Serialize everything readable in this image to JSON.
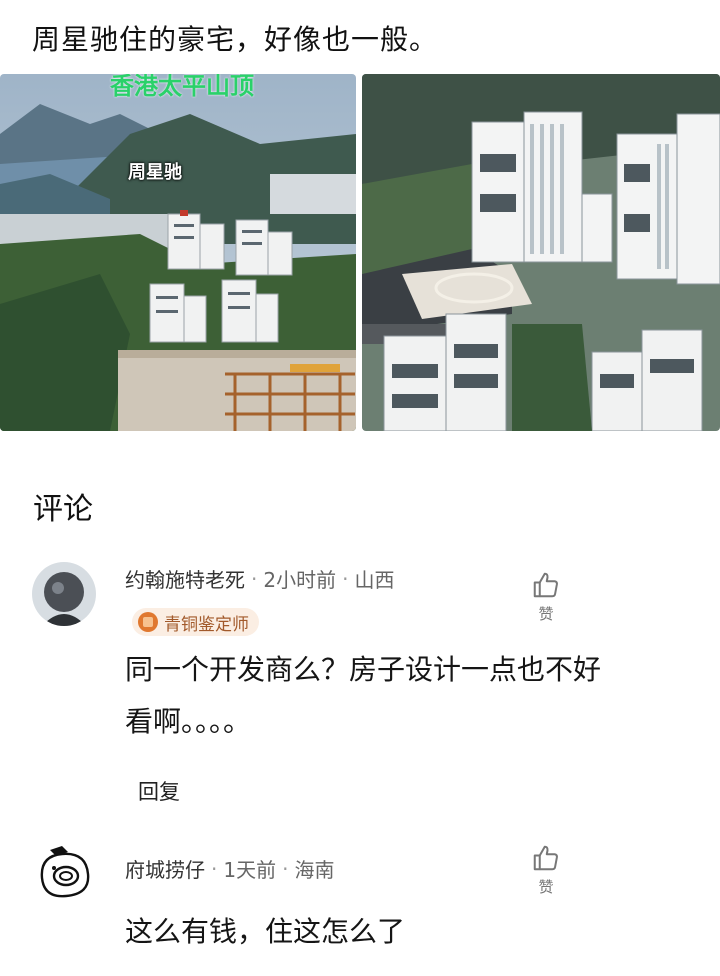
{
  "post": {
    "title": "周星驰住的豪宅，好像也一般。",
    "photos": [
      {
        "top_caption": "香港太平山顶",
        "label": "周星驰"
      },
      {}
    ]
  },
  "comments_section": {
    "title": "评论",
    "comments": [
      {
        "user": "约翰施特老死",
        "time": "2小时前",
        "location": "山西",
        "badge": "青铜鉴定师",
        "text_line1": "同一个开发商么？房子设计一点也不好",
        "text_line2": "看啊。。。。",
        "like_label": "赞",
        "reply_label": "回复"
      },
      {
        "user": "府城捞仔",
        "time": "1天前",
        "location": "海南",
        "text_line1": "这么有钱，住这怎么了",
        "like_label": "赞"
      }
    ],
    "separator": "·"
  }
}
